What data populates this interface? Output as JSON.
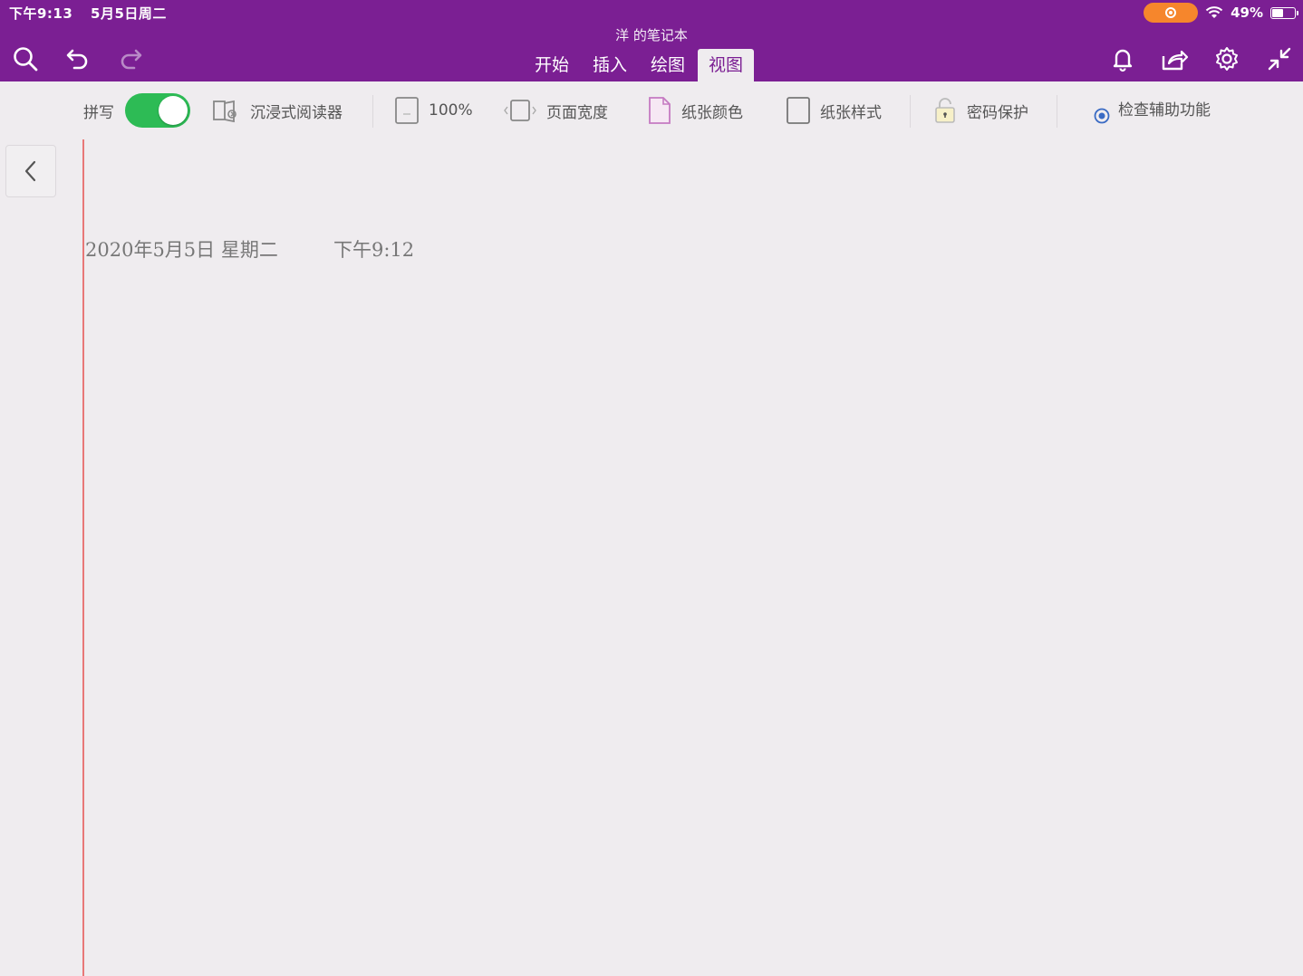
{
  "status_bar": {
    "time": "下午9:13",
    "date": "5月5日周二",
    "battery": "49%",
    "battery_level": 0.49
  },
  "header": {
    "notebook_title": "洋 的笔记本",
    "tabs": [
      {
        "label": "开始",
        "active": false
      },
      {
        "label": "插入",
        "active": false
      },
      {
        "label": "绘图",
        "active": false
      },
      {
        "label": "视图",
        "active": true
      }
    ],
    "icons": [
      "search-icon",
      "undo-icon",
      "redo-icon",
      "bell-icon",
      "share-icon",
      "gear-icon",
      "collapse-icon"
    ]
  },
  "ribbon": {
    "spelling_label": "拼写",
    "spelling_on": true,
    "immersive_reader": "沉浸式阅读器",
    "zoom": "100%",
    "page_width": "页面宽度",
    "paper_color": "纸张颜色",
    "paper_style": "纸张样式",
    "password_protect": "密码保护",
    "accessibility": "检查辅助功能"
  },
  "page": {
    "date": "2020年5月5日 星期二",
    "time": "下午9:12"
  },
  "colors": {
    "brand": "#7b1f93",
    "toggle_on": "#2dbb55",
    "margin_line": "#e87878",
    "recording": "#f6862c"
  }
}
